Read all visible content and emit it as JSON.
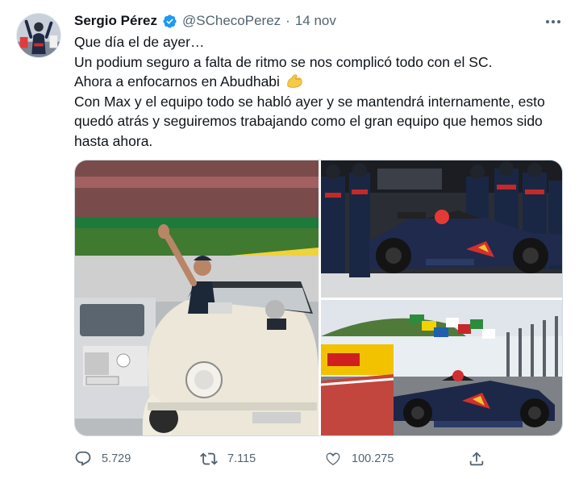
{
  "author": {
    "display_name": "Sergio Pérez",
    "handle": "@SChecoPerez",
    "separator": "·",
    "date": "14 nov",
    "verified": true
  },
  "tweet": {
    "lines": [
      "Que día el de ayer…",
      "Un podium seguro a falta de ritmo se nos complicó todo con el SC.",
      "Ahora a enfocarnos en Abudhabi",
      "Con Max y el equipo todo se habló ayer y se mantendrá internamente, esto",
      "quedó atrás y seguiremos trabajando como el gran equipo que hemos sido",
      "hasta ahora."
    ],
    "emoji": "flexed-biceps"
  },
  "media": {
    "count": 3,
    "photos": [
      {
        "name": "driver-parade-photo",
        "icon": "driver-waving-in-convertible"
      },
      {
        "name": "pit-stop-photo",
        "icon": "red-bull-f1-car-pit-stop"
      },
      {
        "name": "race-track-photo",
        "icon": "red-bull-f1-car-on-track"
      }
    ]
  },
  "actions": {
    "reply_count": "5.729",
    "retweet_count": "7.115",
    "like_count": "100.275"
  },
  "colors": {
    "text_primary": "#0f1419",
    "text_secondary": "#536471",
    "verified_blue": "#1d9bf0",
    "border": "#cfd9de"
  }
}
